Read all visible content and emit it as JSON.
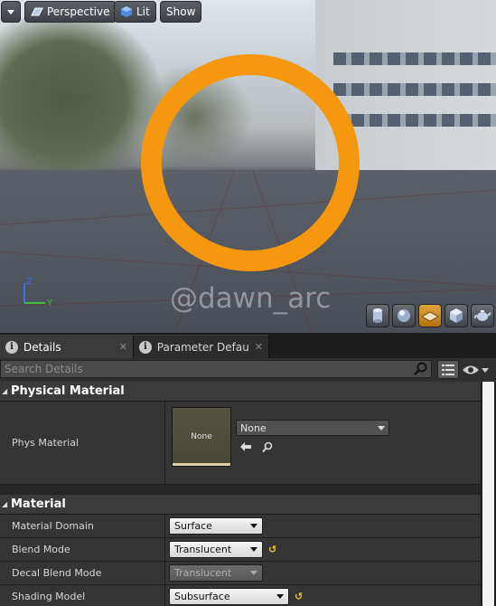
{
  "viewport": {
    "menu_icon": "chevron-down-icon",
    "perspective_label": "Perspective",
    "lit_label": "Lit",
    "show_label": "Show",
    "watermark": "@dawn_arc",
    "axis": {
      "z": "Z",
      "y": "Y"
    },
    "ring_color": "#f6980f",
    "tools": [
      "cylinder-icon",
      "sphere-icon",
      "plane-icon",
      "cube-icon",
      "teapot-icon"
    ],
    "active_tool": "plane-icon"
  },
  "tabs": [
    {
      "label": "Details",
      "active": true
    },
    {
      "label": "Parameter Defaults",
      "active": false
    }
  ],
  "search": {
    "placeholder": "Search Details",
    "value": ""
  },
  "categories": {
    "physical_material": {
      "title": "Physical Material",
      "phys_material": {
        "label": "Phys Material",
        "thumbnail_text": "None",
        "value": "None"
      }
    },
    "material": {
      "title": "Material",
      "rows": [
        {
          "label": "Material Domain",
          "value": "Surface",
          "enabled": true,
          "reset": false
        },
        {
          "label": "Blend Mode",
          "value": "Translucent",
          "enabled": true,
          "reset": true
        },
        {
          "label": "Decal Blend Mode",
          "value": "Translucent",
          "enabled": false,
          "reset": false
        },
        {
          "label": "Shading Model",
          "value": "Subsurface",
          "enabled": true,
          "reset": true
        }
      ]
    }
  },
  "colors": {
    "accent": "#f6980f",
    "reset": "#f3c81a",
    "panel": "#262626"
  }
}
